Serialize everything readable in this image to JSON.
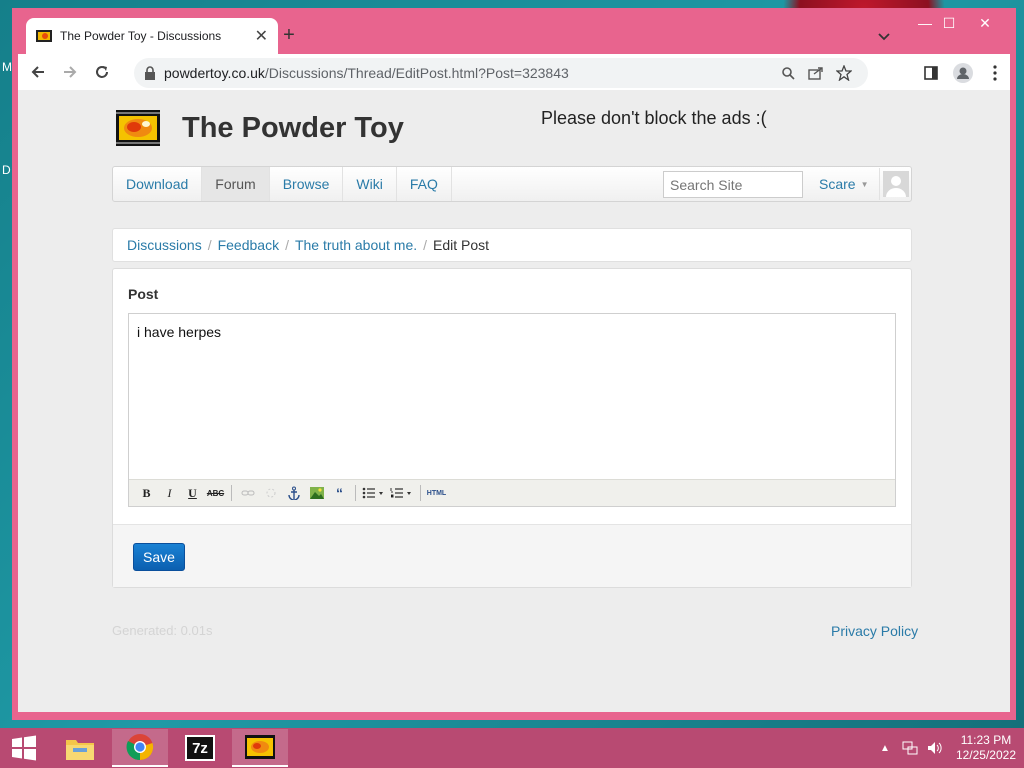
{
  "desktop": {
    "letters": [
      "M",
      "D"
    ]
  },
  "browser": {
    "tab_title": "The Powder Toy - Discussions",
    "url_host": "powdertoy.co.uk",
    "url_path": "/Discussions/Thread/EditPost.html?Post=323843"
  },
  "site": {
    "title": "The Powder Toy",
    "ad_text": "Please don't block the ads :(",
    "nav": [
      "Download",
      "Forum",
      "Browse",
      "Wiki",
      "FAQ"
    ],
    "active_nav": "Forum",
    "search_placeholder": "Search Site",
    "user_name": "Scare"
  },
  "breadcrumb": {
    "items": [
      "Discussions",
      "Feedback",
      "The truth about me."
    ],
    "separator": "/",
    "current": "Edit Post"
  },
  "post": {
    "label": "Post",
    "content": "i have herpes",
    "toolbar_html_label": "HTML",
    "save_label": "Save"
  },
  "footer": {
    "generated": "Generated: 0.01s",
    "privacy": "Privacy Policy"
  },
  "taskbar": {
    "time": "11:23 PM",
    "date": "12/25/2022",
    "seven_zip_label": "7z"
  },
  "colors": {
    "window_frame": "#e8648e",
    "link": "#2a7ba8",
    "save_button": "#0b5fb0",
    "taskbar": "#b84a72"
  }
}
